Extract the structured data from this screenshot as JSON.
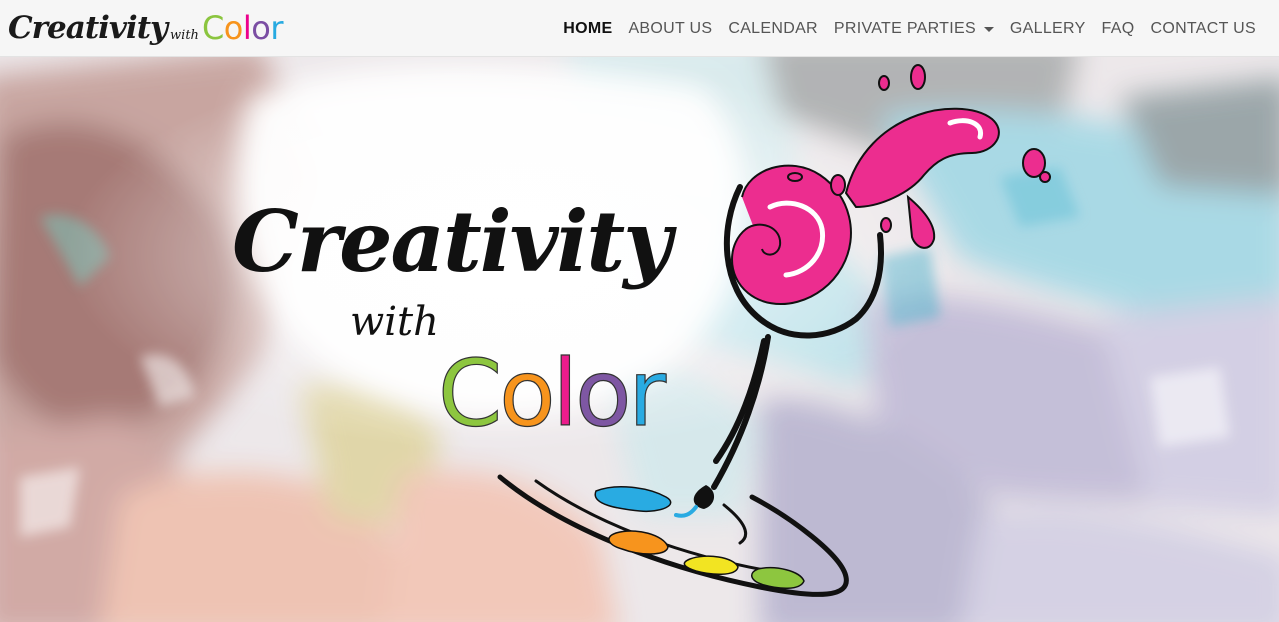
{
  "brand": {
    "creativity": "Creativity",
    "with": "with",
    "color_letters": [
      {
        "ch": "C",
        "color": "#8bc53f"
      },
      {
        "ch": "o",
        "color": "#f7941d"
      },
      {
        "ch": "l",
        "color": "#ec008c"
      },
      {
        "ch": "o",
        "color": "#7b4ea3"
      },
      {
        "ch": "r",
        "color": "#27aae1"
      }
    ]
  },
  "nav": {
    "items": [
      {
        "label": "HOME",
        "active": true
      },
      {
        "label": "ABOUT US"
      },
      {
        "label": "CALENDAR"
      },
      {
        "label": "PRIVATE PARTIES",
        "dropdown": true
      },
      {
        "label": "GALLERY"
      },
      {
        "label": "FAQ"
      },
      {
        "label": "CONTACT US"
      }
    ]
  },
  "hero": {
    "logo_creativity": "Creativity",
    "logo_with": "with",
    "logo_color_letters": [
      {
        "ch": "C",
        "color": "#8dc63f"
      },
      {
        "ch": "o",
        "color": "#f7941d"
      },
      {
        "ch": "l",
        "color": "#ec1c8c"
      },
      {
        "ch": "o",
        "color": "#7e57a3"
      },
      {
        "ch": "r",
        "color": "#29abe2"
      }
    ],
    "splash_color": "#ec2d8f",
    "palette_paint_colors": [
      "#29abe2",
      "#f7941d",
      "#f2e422",
      "#8dc63f"
    ]
  },
  "colors": {
    "navbar_bg": "#f6f6f6",
    "nav_text": "#555555",
    "nav_active": "#111111"
  }
}
